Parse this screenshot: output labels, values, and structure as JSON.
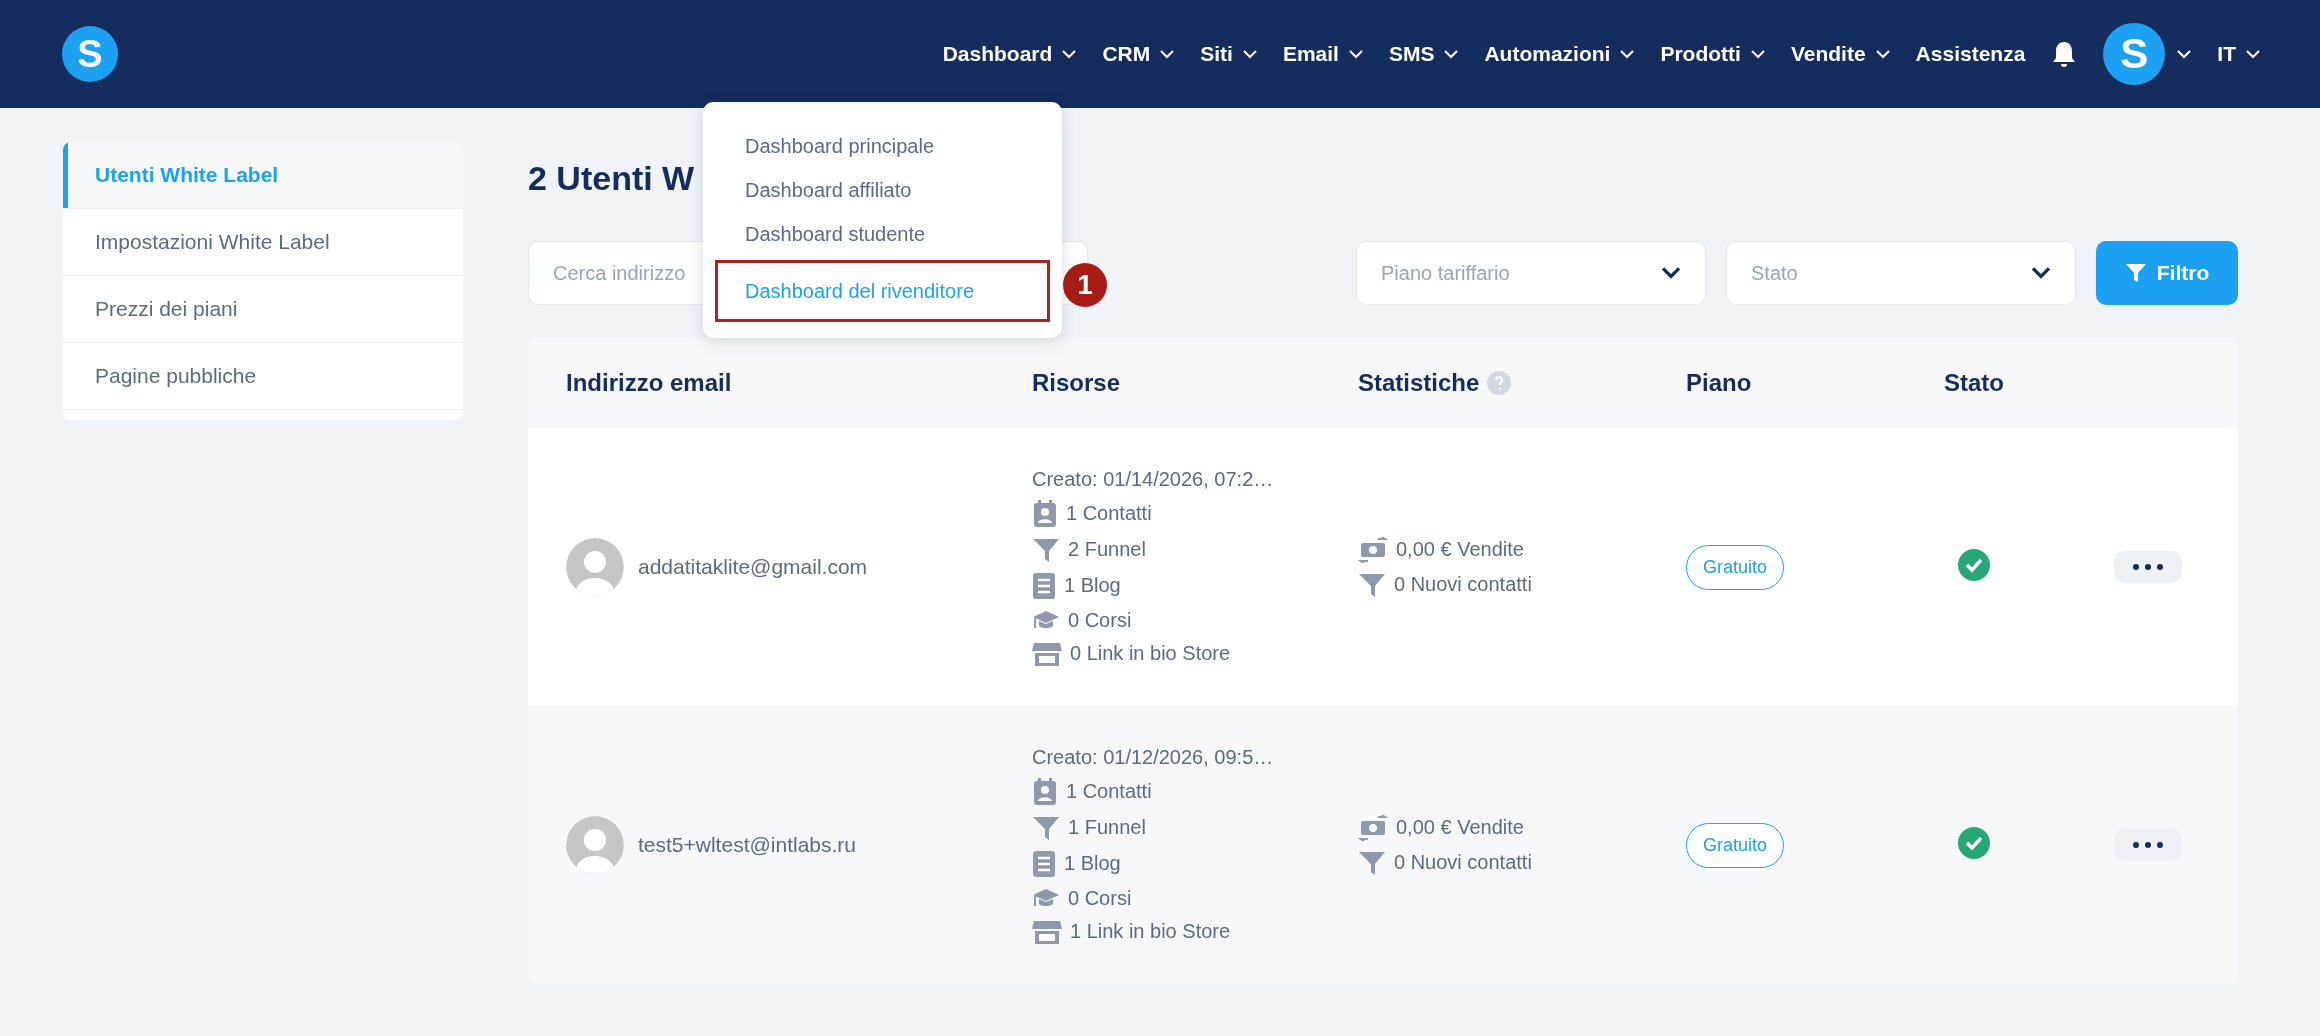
{
  "header": {
    "logo": "S",
    "nav": [
      {
        "label": "Dashboard",
        "caret": true
      },
      {
        "label": "CRM",
        "caret": true
      },
      {
        "label": "Siti",
        "caret": true
      },
      {
        "label": "Email",
        "caret": true
      },
      {
        "label": "SMS",
        "caret": true
      },
      {
        "label": "Automazioni",
        "caret": true
      },
      {
        "label": "Prodotti",
        "caret": true
      },
      {
        "label": "Vendite",
        "caret": true
      },
      {
        "label": "Assistenza",
        "caret": false
      }
    ],
    "avatar": "S",
    "language": "IT"
  },
  "dropdown": {
    "items": [
      {
        "label": "Dashboard principale",
        "selected": false
      },
      {
        "label": "Dashboard affiliato",
        "selected": false
      },
      {
        "label": "Dashboard studente",
        "selected": false
      },
      {
        "label": "Dashboard del rivenditore",
        "selected": true
      }
    ],
    "callout": "1"
  },
  "sidebar": {
    "items": [
      {
        "label": "Utenti White Label",
        "selected": true
      },
      {
        "label": "Impostazioni White Label",
        "selected": false
      },
      {
        "label": "Prezzi dei piani",
        "selected": false
      },
      {
        "label": "Pagine pubbliche",
        "selected": false
      }
    ]
  },
  "title": "2 Utenti W",
  "filters": {
    "search_placeholder": "Cerca indirizzo",
    "plan_placeholder": "Piano tariffario",
    "status_placeholder": "Stato",
    "button": "Filtro"
  },
  "table": {
    "columns": [
      "Indirizzo email",
      "Risorse",
      "Statistiche",
      "Piano",
      "Stato"
    ],
    "rows": [
      {
        "email": "addatitaklite@gmail.com",
        "created": "Creato: 01/14/2026, 07:2…",
        "resources": [
          {
            "kind": "contacts",
            "text": "1 Contatti"
          },
          {
            "kind": "funnel",
            "text": "2 Funnel"
          },
          {
            "kind": "blog",
            "text": "1 Blog"
          },
          {
            "kind": "course",
            "text": "0 Corsi"
          },
          {
            "kind": "store",
            "text": "0 Link in bio Store"
          }
        ],
        "stats": [
          {
            "kind": "money",
            "text": "0,00 € Vendite"
          },
          {
            "kind": "funnel",
            "text": "0 Nuovi contatti"
          }
        ],
        "plan": "Gratuito",
        "active": true
      },
      {
        "email": "test5+wltest@intlabs.ru",
        "created": "Creato: 01/12/2026, 09:5…",
        "resources": [
          {
            "kind": "contacts",
            "text": "1 Contatti"
          },
          {
            "kind": "funnel",
            "text": "1 Funnel"
          },
          {
            "kind": "blog",
            "text": "1 Blog"
          },
          {
            "kind": "course",
            "text": "0 Corsi"
          },
          {
            "kind": "store",
            "text": "1 Link in bio Store"
          }
        ],
        "stats": [
          {
            "kind": "money",
            "text": "0,00 € Vendite"
          },
          {
            "kind": "funnel",
            "text": "0 Nuovi contatti"
          }
        ],
        "plan": "Gratuito",
        "active": true
      }
    ]
  }
}
